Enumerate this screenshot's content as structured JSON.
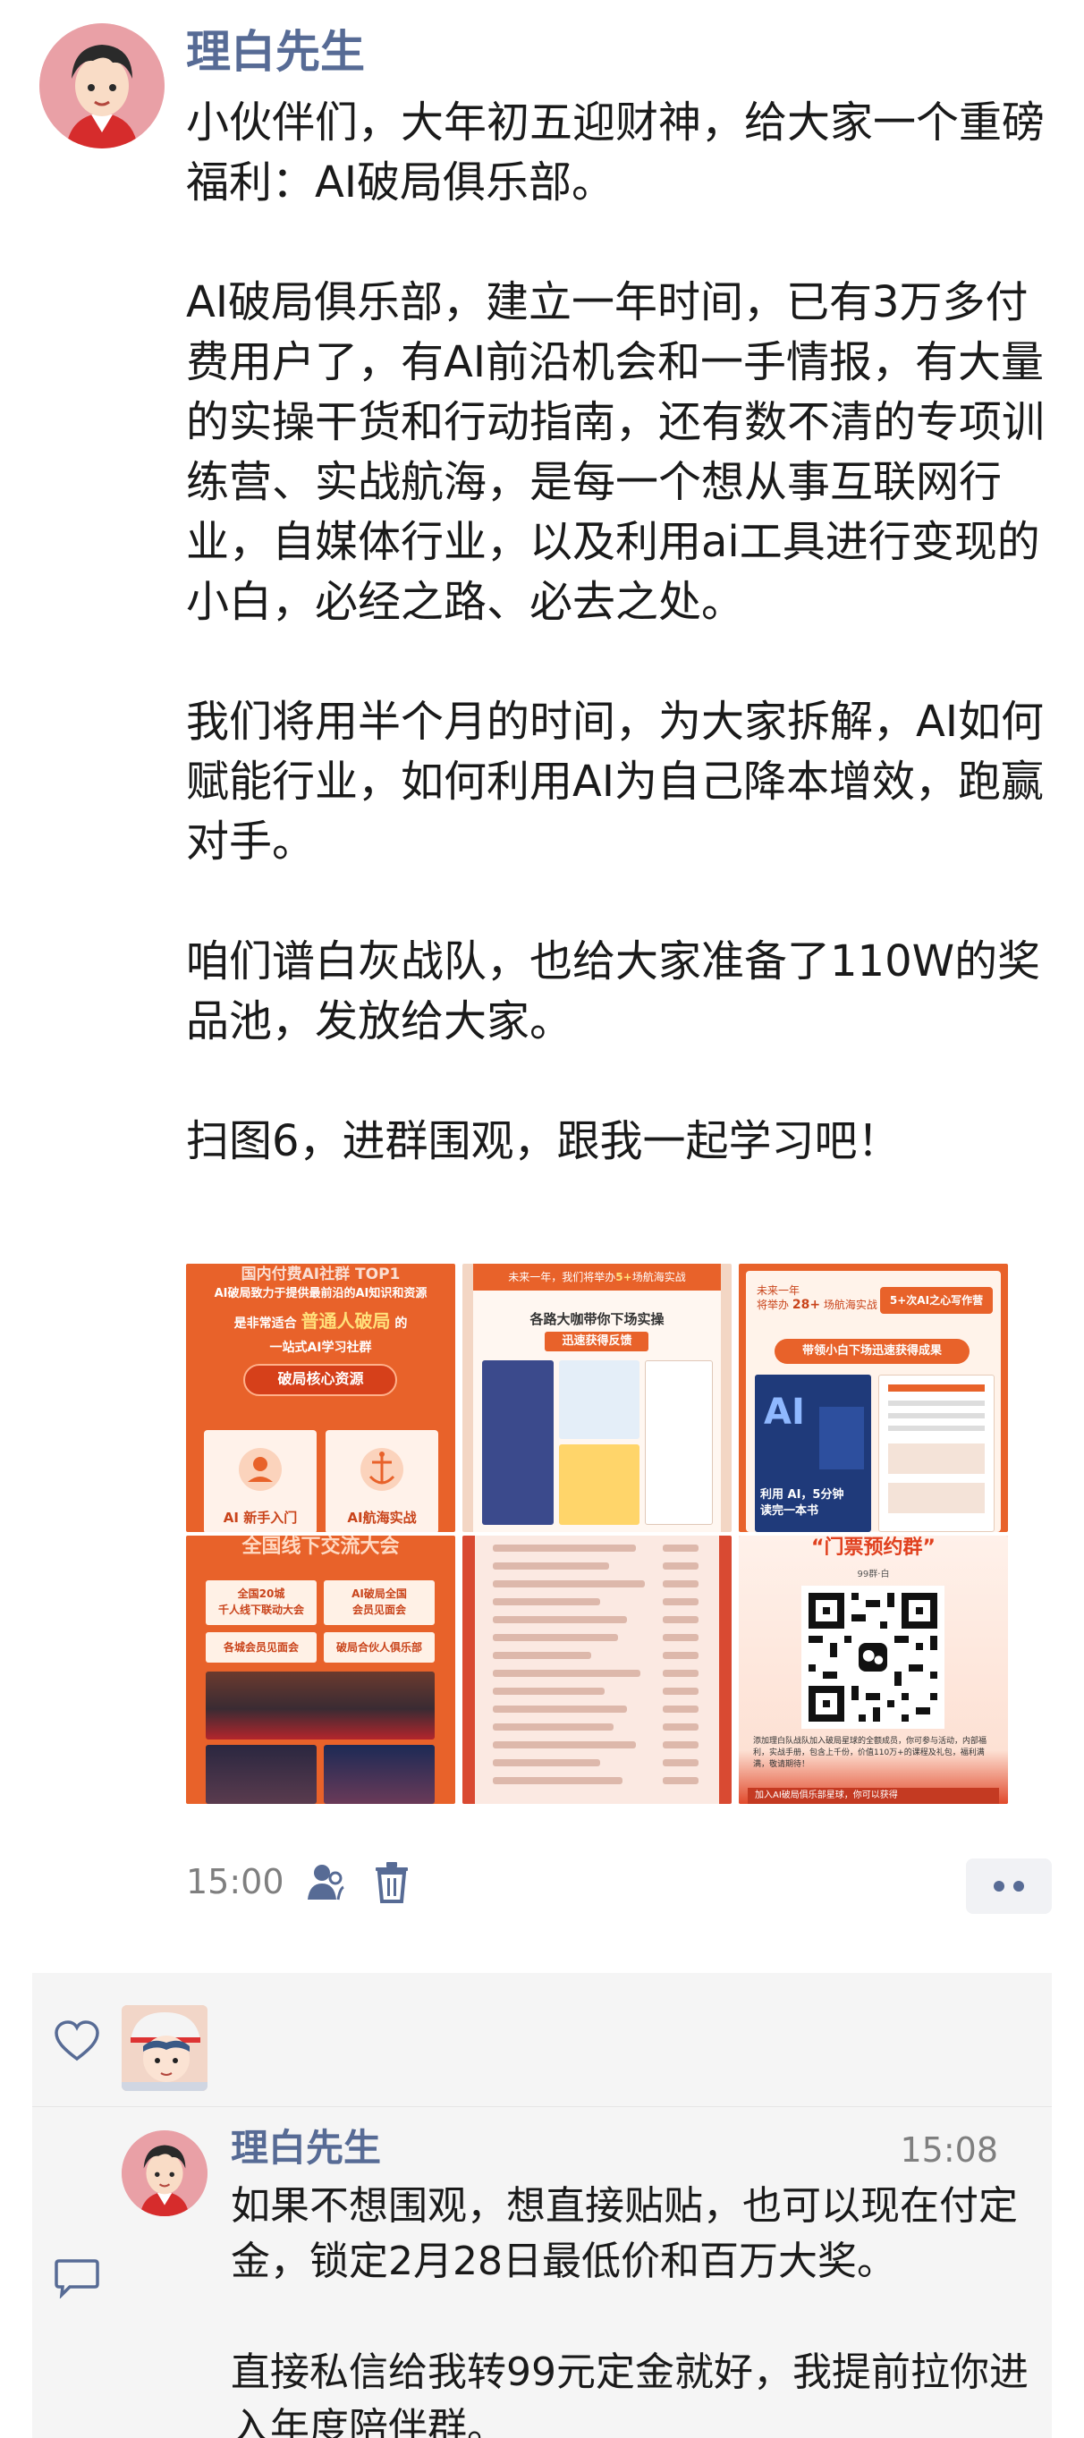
{
  "post": {
    "author": "理白先生",
    "paragraphs": [
      "小伙伴们，大年初五迎财神，给大家一个重磅福利：AI破局俱乐部。",
      "AI破局俱乐部，建立一年时间，已有3万多付费用户了，有AI前沿机会和一手情报，有大量的实操干货和行动指南，还有数不清的专项训练营、实战航海，是每一个想从事互联网行业，自媒体行业，以及利用ai工具进行变现的小白，必经之路、必去之处。",
      "我们将用半个月的时间，为大家拆解，AI如何赋能行业，如何利用AI为自己降本增效，跑赢对手。",
      "咱们谱白灰战队，也给大家准备了110W的奖品池，发放给大家。",
      "扫图6，进群围观，跟我一起学习吧！"
    ],
    "time": "15:00",
    "images": {
      "img1": {
        "line1": "国内付费AI社群 TOP1",
        "line2": "AI破局致力于提供最前沿的AI知识和资源",
        "line3a": "是非常适合",
        "line3b": "普通人破局",
        "line3c": "的",
        "line4": "一站式AI学习社群",
        "button": "破局核心资源",
        "card1": "AI 新手入门",
        "card2": "AI航海实战"
      },
      "img2": {
        "line1": "未来一年，我们将举办",
        "line1b": "5+",
        "line1c": "场航海实战",
        "line2": "各路大咖带你下场实操",
        "line3": "迅速获得反馈"
      },
      "img3": {
        "line1": "未来一年",
        "line2": "将举办",
        "line2b": "28+",
        "line2c": "场航海实战",
        "badge": "5+次AI之心写作营",
        "banner": "带领小白下场迅速获得成果",
        "book1": "利用 AI，5分钟",
        "book2": "读完一本书"
      },
      "img4": {
        "header": "全国线下交流大会",
        "item1": "全国20城",
        "item1b": "千人线下联动大会",
        "item2": "AI破局全国",
        "item2b": "会员见面会",
        "item3": "各城会员见面会",
        "item4": "破局合伙人俱乐部"
      },
      "img6": {
        "title": "“门票预约群”",
        "sub": "99群·白",
        "caption": "添加理白队战队加入破局星球的全额成员，你可参与活动，内部福利，实战手册，包含上千份，价值110万+的课程及礼包，福利满满，敬请期待！",
        "footer": "加入AI破局俱乐部星球，你可以获得"
      }
    }
  },
  "interaction": {
    "comment": {
      "author": "理白先生",
      "time": "15:08",
      "paragraphs": [
        "如果不想围观，想直接贴贴，也可以现在付定金，锁定2月28日最低价和百万大奖。",
        "直接私信给我转99元定金就好，我提前拉你进入年度陪伴群。"
      ]
    }
  },
  "colors": {
    "link": "#576b95",
    "accent": "#e8622a",
    "accent_dark": "#c9441b",
    "muted": "#7f7f7f"
  },
  "icons": [
    "person-icon",
    "trash-icon",
    "more-icon",
    "heart-icon",
    "comment-icon"
  ]
}
